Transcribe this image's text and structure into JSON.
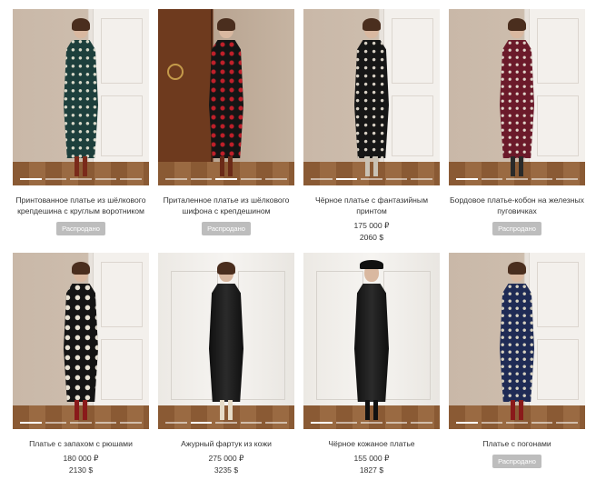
{
  "products": [
    {
      "title": "Принтованное платье из шёлкового крепдешина с круглым воротником",
      "status": "Распродано",
      "price_rub": "",
      "price_usd": "",
      "dress": "green-print",
      "background": "room"
    },
    {
      "title": "Приталенное платье из шёлкового шифона с крепдешином",
      "status": "Распродано",
      "price_rub": "",
      "price_usd": "",
      "dress": "black-red-print",
      "background": "dark-cabinet"
    },
    {
      "title": "Чёрное платье с фантазийным принтом",
      "status": "",
      "price_rub": "175 000 ₽",
      "price_usd": "2060 $",
      "dress": "black-flower-print",
      "background": "room"
    },
    {
      "title": "Бордовое платье-кобон на железных пуговичках",
      "status": "Распродано",
      "price_rub": "",
      "price_usd": "",
      "dress": "burgundy-print",
      "background": "room"
    },
    {
      "title": "Платье с запахом с рюшами",
      "status": "",
      "price_rub": "180 000 ₽",
      "price_usd": "2130 $",
      "dress": "black-floral",
      "background": "room"
    },
    {
      "title": "Ажурный фартук из кожи",
      "status": "",
      "price_rub": "275 000 ₽",
      "price_usd": "3235 $",
      "dress": "black-leather",
      "background": "white-room"
    },
    {
      "title": "Чёрное кожаное платье",
      "status": "",
      "price_rub": "155 000 ₽",
      "price_usd": "1827 $",
      "dress": "black-leather",
      "background": "white-room"
    },
    {
      "title": "Платье с погонами",
      "status": "Распродано",
      "price_rub": "",
      "price_usd": "",
      "dress": "navy-print",
      "background": "room"
    }
  ]
}
